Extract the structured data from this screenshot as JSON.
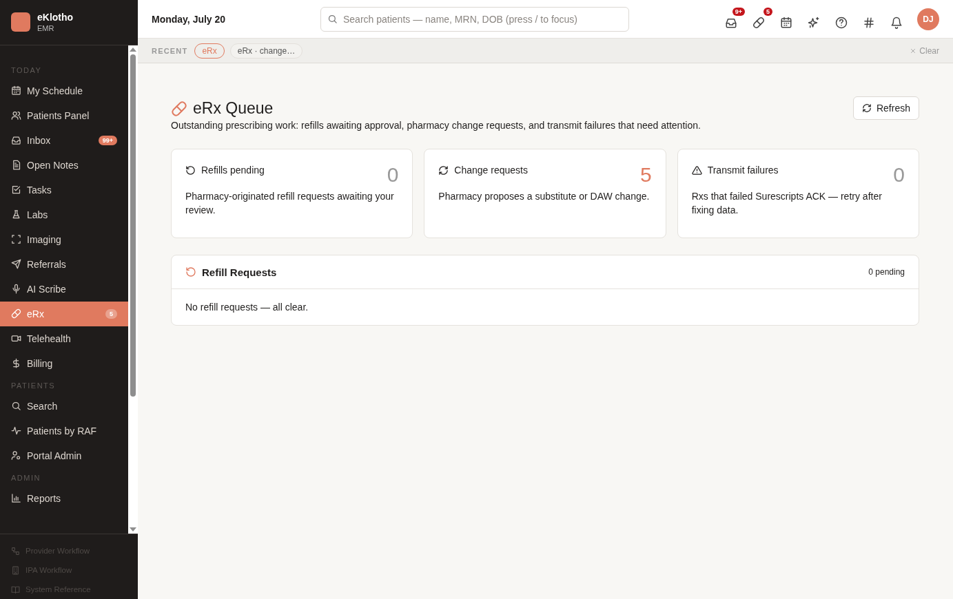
{
  "brand": {
    "name": "eKlotho",
    "subtitle": "EMR"
  },
  "sidebar": {
    "sections": [
      {
        "title": "TODAY",
        "items": [
          {
            "kind": "calendar",
            "label": "My Schedule",
            "selected": false
          },
          {
            "kind": "users",
            "label": "Patients Panel",
            "selected": false
          },
          {
            "kind": "inbox",
            "label": "Inbox",
            "badge": "99+",
            "selected": false
          },
          {
            "kind": "note",
            "label": "Open Notes",
            "selected": false
          },
          {
            "kind": "task",
            "label": "Tasks",
            "selected": false
          },
          {
            "kind": "flask",
            "label": "Labs",
            "selected": false
          },
          {
            "kind": "scan",
            "label": "Imaging",
            "selected": false
          },
          {
            "kind": "send",
            "label": "Referrals",
            "selected": false
          },
          {
            "kind": "mic",
            "label": "AI Scribe",
            "selected": false
          },
          {
            "kind": "pill",
            "label": "eRx",
            "badge": "5",
            "selected": true
          },
          {
            "kind": "video",
            "label": "Telehealth",
            "selected": false
          },
          {
            "kind": "dollar",
            "label": "Billing",
            "selected": false
          }
        ]
      },
      {
        "title": "PATIENTS",
        "items": [
          {
            "kind": "search",
            "label": "Search",
            "selected": false
          },
          {
            "kind": "pulse",
            "label": "Patients by RAF",
            "selected": false
          },
          {
            "kind": "usercog",
            "label": "Portal Admin",
            "selected": false
          }
        ]
      },
      {
        "title": "ADMIN",
        "items": [
          {
            "kind": "chart",
            "label": "Reports",
            "selected": false
          }
        ]
      }
    ],
    "footer_links": [
      {
        "kind": "workflow",
        "label": "Provider Workflow",
        "disabled": true
      },
      {
        "kind": "building",
        "label": "IPA Workflow",
        "disabled": true
      },
      {
        "kind": "book",
        "label": "System Reference",
        "disabled": true
      }
    ]
  },
  "header": {
    "date": "Monday, July 20",
    "search": {
      "placeholder": "Search patients — name, MRN, DOB (press / to focus)"
    },
    "toolbar": [
      {
        "kind": "inbox",
        "badge": "9+"
      },
      {
        "kind": "pill",
        "badge": "5"
      },
      {
        "kind": "calendar"
      },
      {
        "kind": "sparkles"
      },
      {
        "kind": "help"
      },
      {
        "kind": "hash"
      },
      {
        "kind": "bell"
      }
    ],
    "avatar": {
      "initials": "DJ"
    }
  },
  "recent": {
    "label": "RECENT",
    "chips": [
      {
        "label": "eRx",
        "selected": true
      },
      {
        "label": "eRx · change…",
        "selected": false
      }
    ],
    "clear": "Clear"
  },
  "page": {
    "title": "eRx Queue",
    "description": "Outstanding prescribing work: refills awaiting approval, pharmacy change requests, and transmit failures that need attention.",
    "refresh": "Refresh",
    "cards": [
      {
        "kind": "refill",
        "title": "Refills pending",
        "count": "0",
        "alert": false,
        "description": "Pharmacy-originated refill requests awaiting your review."
      },
      {
        "kind": "change",
        "title": "Change requests",
        "count": "5",
        "alert": true,
        "description": "Pharmacy proposes a substitute or DAW change."
      },
      {
        "kind": "warning",
        "title": "Transmit failures",
        "count": "0",
        "alert": false,
        "description": "Rxs that failed Surescripts ACK — retry after fixing data."
      }
    ],
    "panel": {
      "title": "Refill Requests",
      "count": "0 pending",
      "empty": "No refill requests — all clear."
    }
  }
}
